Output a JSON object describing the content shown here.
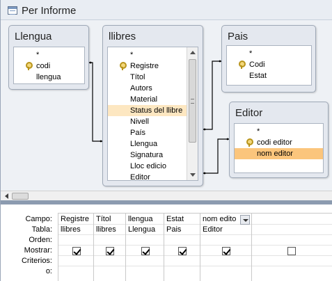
{
  "window": {
    "title": "Per Informe"
  },
  "tables": {
    "llengua": {
      "title": "Llengua",
      "fields": [
        {
          "label": "*",
          "key": false
        },
        {
          "label": "codi",
          "key": true
        },
        {
          "label": "llengua",
          "key": false
        }
      ]
    },
    "llibres": {
      "title": "llibres",
      "fields": [
        {
          "label": "*",
          "key": false
        },
        {
          "label": "Registre",
          "key": true
        },
        {
          "label": "Títol",
          "key": false
        },
        {
          "label": "Autors",
          "key": false
        },
        {
          "label": "Material",
          "key": false
        },
        {
          "label": "Status del llibre",
          "key": false
        },
        {
          "label": "Nivell",
          "key": false
        },
        {
          "label": "País",
          "key": false
        },
        {
          "label": "Llengua",
          "key": false
        },
        {
          "label": "Signatura",
          "key": false
        },
        {
          "label": "Lloc edicio",
          "key": false
        },
        {
          "label": "Editor",
          "key": false
        }
      ]
    },
    "pais": {
      "title": "Pais",
      "fields": [
        {
          "label": "*",
          "key": false
        },
        {
          "label": "Codi",
          "key": true
        },
        {
          "label": "Estat",
          "key": false
        }
      ]
    },
    "editor": {
      "title": "Editor",
      "fields": [
        {
          "label": "*",
          "key": false
        },
        {
          "label": "codi editor",
          "key": true
        },
        {
          "label": "nom editor",
          "key": false
        }
      ]
    }
  },
  "grid": {
    "row_labels": [
      "Campo:",
      "Tabla:",
      "Orden:",
      "Mostrar:",
      "Criterios:",
      "o:"
    ],
    "columns": [
      {
        "campo": "Registre",
        "tabla": "llibres",
        "mostrar": true
      },
      {
        "campo": "Títol",
        "tabla": "llibres",
        "mostrar": true
      },
      {
        "campo": "llengua",
        "tabla": "Llengua",
        "mostrar": true
      },
      {
        "campo": "Estat",
        "tabla": "Pais",
        "mostrar": true
      },
      {
        "campo": "nom edito",
        "tabla": "Editor",
        "mostrar": true
      },
      {
        "campo": "",
        "tabla": "",
        "mostrar": false
      }
    ]
  }
}
